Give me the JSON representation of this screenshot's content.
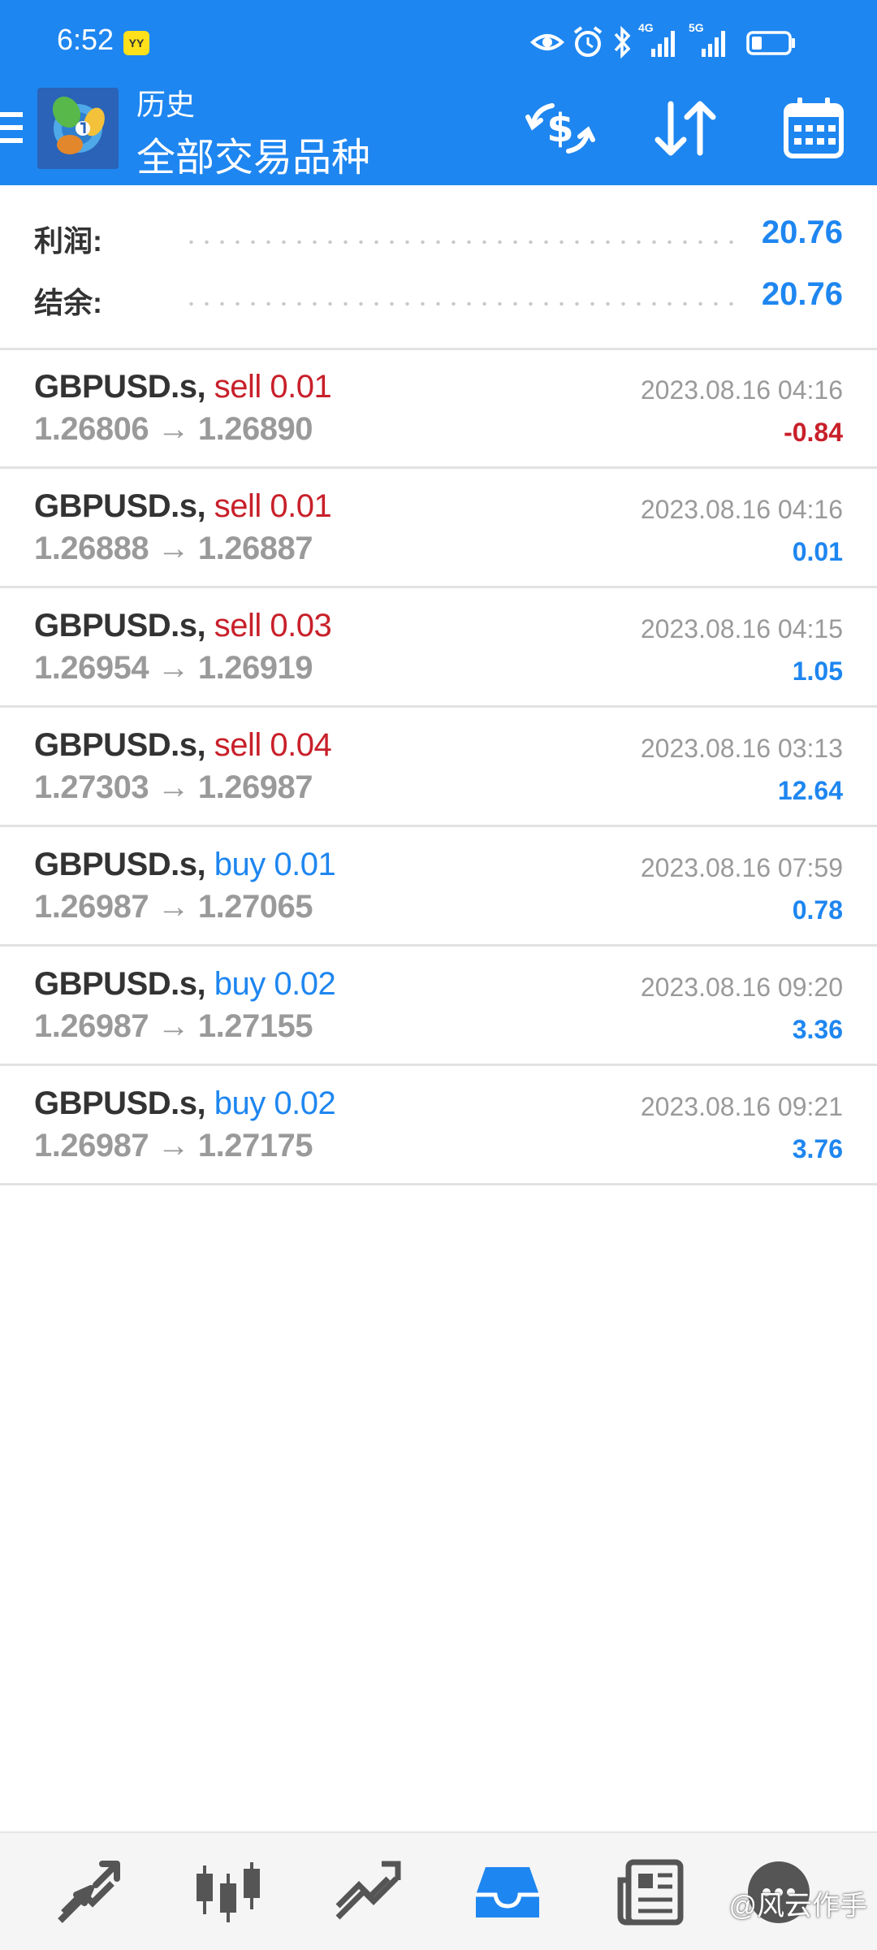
{
  "status_bar": {
    "time": "6:52",
    "badge": "YY",
    "network_1": "4G",
    "network_2": "5G"
  },
  "app_bar": {
    "title": "历史",
    "subtitle": "全部交易品种",
    "icons": [
      "menu-icon",
      "currency-swap-icon",
      "sort-icon",
      "calendar-icon"
    ]
  },
  "summary": {
    "profit_label": "利润:",
    "profit_value": "20.76",
    "balance_label": "结余:",
    "balance_value": "20.76"
  },
  "colors": {
    "brand": "#1e86f0",
    "sell": "#c8202a",
    "buy": "#1e86f0",
    "loss": "#c8202a",
    "gain": "#1e86f0"
  },
  "trades": [
    {
      "symbol": "GBPUSD.s,",
      "side": "sell 0.01",
      "open": "1.26806",
      "close": "1.26890",
      "time": "2023.08.16 04:16",
      "profit": "-0.84"
    },
    {
      "symbol": "GBPUSD.s,",
      "side": "sell 0.01",
      "open": "1.26888",
      "close": "1.26887",
      "time": "2023.08.16 04:16",
      "profit": "0.01"
    },
    {
      "symbol": "GBPUSD.s,",
      "side": "sell 0.03",
      "open": "1.26954",
      "close": "1.26919",
      "time": "2023.08.16 04:15",
      "profit": "1.05"
    },
    {
      "symbol": "GBPUSD.s,",
      "side": "sell 0.04",
      "open": "1.27303",
      "close": "1.26987",
      "time": "2023.08.16 03:13",
      "profit": "12.64"
    },
    {
      "symbol": "GBPUSD.s,",
      "side": "buy 0.01",
      "open": "1.26987",
      "close": "1.27065",
      "time": "2023.08.16 07:59",
      "profit": "0.78"
    },
    {
      "symbol": "GBPUSD.s,",
      "side": "buy 0.02",
      "open": "1.26987",
      "close": "1.27155",
      "time": "2023.08.16 09:20",
      "profit": "3.36"
    },
    {
      "symbol": "GBPUSD.s,",
      "side": "buy 0.02",
      "open": "1.26987",
      "close": "1.27175",
      "time": "2023.08.16 09:21",
      "profit": "3.76"
    }
  ],
  "arrow": "→",
  "bottom_nav": {
    "items": [
      "quotes-icon",
      "chart-candles-icon",
      "trade-icon",
      "history-inbox-icon",
      "news-icon",
      "chat-icon"
    ],
    "active": "history-inbox-icon"
  },
  "watermark": "@风云作手"
}
